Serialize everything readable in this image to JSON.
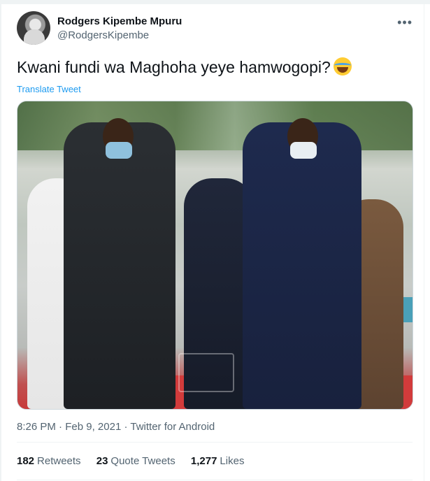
{
  "author": {
    "display_name": "Rodgers Kipembe Mpuru",
    "handle": "@RodgersKipembe"
  },
  "tweet": {
    "text": "Kwani fundi wa Maghoha yeye hamwogopi?",
    "emoji_icon": "face-with-tears-of-joy-icon",
    "translate_label": "Translate Tweet",
    "time": "8:26 PM",
    "date": "Feb 9, 2021",
    "source": "Twitter for Android"
  },
  "stats": {
    "retweets_count": "182",
    "retweets_label": "Retweets",
    "quotes_count": "23",
    "quotes_label": "Quote Tweets",
    "likes_count": "1,277",
    "likes_label": "Likes"
  },
  "menu": {
    "more_icon": "more-dots-icon"
  },
  "colors": {
    "link": "#1d9bf0",
    "secondary_text": "#536471",
    "primary_text": "#0f1419"
  }
}
